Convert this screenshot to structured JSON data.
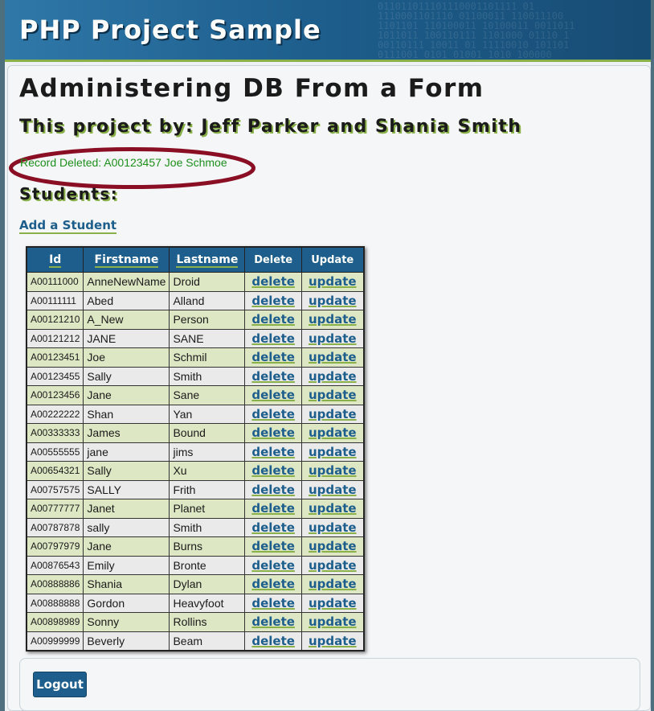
{
  "header": {
    "title": "PHP Project Sample"
  },
  "page": {
    "heading": "Administering DB From a Form",
    "subheading": "This project by: Jeff Parker and Shania Smith",
    "message": "Record Deleted: A00123457 Joe Schmoe",
    "section_title": "Students:",
    "add_link": "Add a Student",
    "logout_label": "Logout"
  },
  "table": {
    "headers": {
      "id": "Id",
      "firstname": "Firstname",
      "lastname": "Lastname",
      "delete": "Delete",
      "update": "Update"
    },
    "delete_label": "delete",
    "update_label": "update",
    "rows": [
      {
        "id": "A00111000",
        "first": "AnneNewName",
        "last": "Droid"
      },
      {
        "id": "A00111111",
        "first": "Abed",
        "last": "Alland"
      },
      {
        "id": "A00121210",
        "first": "A_New",
        "last": "Person"
      },
      {
        "id": "A00121212",
        "first": "JANE",
        "last": "SANE"
      },
      {
        "id": "A00123451",
        "first": "Joe",
        "last": "Schmil"
      },
      {
        "id": "A00123455",
        "first": "Sally",
        "last": "Smith"
      },
      {
        "id": "A00123456",
        "first": "Jane",
        "last": "Sane"
      },
      {
        "id": "A00222222",
        "first": "Shan",
        "last": "Yan"
      },
      {
        "id": "A00333333",
        "first": "James",
        "last": "Bound"
      },
      {
        "id": "A00555555",
        "first": "jane",
        "last": "jims"
      },
      {
        "id": "A00654321",
        "first": "Sally",
        "last": "Xu"
      },
      {
        "id": "A00757575",
        "first": "SALLY",
        "last": "Frith"
      },
      {
        "id": "A00777777",
        "first": "Janet",
        "last": "Planet"
      },
      {
        "id": "A00787878",
        "first": "sally",
        "last": "Smith"
      },
      {
        "id": "A00797979",
        "first": "Jane",
        "last": "Burns"
      },
      {
        "id": "A00876543",
        "first": "Emily",
        "last": "Bronte"
      },
      {
        "id": "A00888886",
        "first": "Shania",
        "last": "Dylan"
      },
      {
        "id": "A00888888",
        "first": "Gordon",
        "last": "Heavyfoot"
      },
      {
        "id": "A00898989",
        "first": "Sonny",
        "last": "Rollins"
      },
      {
        "id": "A00999999",
        "first": "Beverly",
        "last": "Beam"
      }
    ]
  },
  "colors": {
    "accent": "#1d5e8c",
    "highlight": "#8ab04a",
    "message": "#1f8f1f",
    "ellipse": "#8a0f24"
  }
}
